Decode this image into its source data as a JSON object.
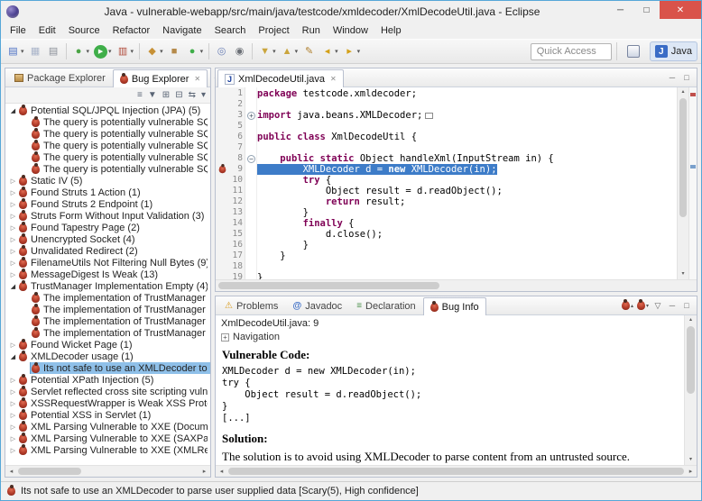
{
  "colors": {
    "window_border": "#56a7d8",
    "close_button": "#d9534a",
    "selection": "#3d7cc8",
    "tree_selection": "#8fc0e9",
    "keyword": "#7f0055",
    "bug": "#b03a28"
  },
  "window": {
    "title": "Java - vulnerable-webapp/src/main/java/testcode/xmldecoder/XmlDecodeUtil.java - Eclipse",
    "controls": {
      "minimize": "─",
      "maximize": "□",
      "close": "✕"
    }
  },
  "menubar": {
    "items": [
      "File",
      "Edit",
      "Source",
      "Refactor",
      "Navigate",
      "Search",
      "Project",
      "Run",
      "Window",
      "Help"
    ]
  },
  "toolbar": {
    "quick_access": "Quick Access",
    "perspective": "Java",
    "buttons": [
      {
        "name": "new-wizard",
        "glyph": "▤",
        "color": "#4a6fc4",
        "dropdown": true
      },
      {
        "name": "save",
        "glyph": "▦",
        "color": "#a9b4c9"
      },
      {
        "name": "print",
        "glyph": "▤",
        "color": "#8a8f98"
      },
      {
        "sep": true
      },
      {
        "name": "debug",
        "glyph": "●",
        "color": "#4ba446",
        "dropdown": true
      },
      {
        "name": "run",
        "glyph": "▶",
        "color": "#ffffff",
        "bg": "#3fae49",
        "dropdown": true
      },
      {
        "name": "coverage",
        "glyph": "▥",
        "color": "#b04a3a",
        "dropdown": true
      },
      {
        "sep": true
      },
      {
        "name": "new-java-project",
        "glyph": "◆",
        "color": "#c79136",
        "dropdown": true
      },
      {
        "name": "new-package",
        "glyph": "■",
        "color": "#b58a4a"
      },
      {
        "name": "new-class",
        "glyph": "●",
        "color": "#3fae49",
        "dropdown": true
      },
      {
        "sep": true
      },
      {
        "name": "open-type",
        "glyph": "◎",
        "color": "#6a7fb5"
      },
      {
        "name": "search",
        "glyph": "◉",
        "color": "#6b6f76"
      },
      {
        "sep": true
      },
      {
        "name": "next-annotation",
        "glyph": "▼",
        "color": "#caa53d",
        "dropdown": true
      },
      {
        "name": "previous-annotation",
        "glyph": "▲",
        "color": "#caa53d",
        "dropdown": true
      },
      {
        "name": "last-edit-location",
        "glyph": "✎",
        "color": "#b08030"
      },
      {
        "name": "back",
        "glyph": "◂",
        "color": "#d4a017",
        "dropdown": true
      },
      {
        "name": "forward",
        "glyph": "▸",
        "color": "#d4a017",
        "dropdown": true
      }
    ]
  },
  "panel_buttons": {
    "minimize": "─",
    "maximize": "□"
  },
  "left_panel": {
    "tabs": [
      {
        "label": "Package Explorer",
        "icon": "package",
        "active": false
      },
      {
        "label": "Bug Explorer",
        "icon": "bug",
        "active": true,
        "closable": true
      }
    ],
    "view_toolbar": [
      {
        "name": "group-by",
        "glyph": "≡"
      },
      {
        "name": "filter",
        "glyph": "▼"
      },
      {
        "name": "expand-all",
        "glyph": "⊞"
      },
      {
        "name": "collapse-all",
        "glyph": "⊟"
      },
      {
        "name": "link-with-editor",
        "glyph": "⇆"
      },
      {
        "name": "view-menu",
        "glyph": "▾"
      }
    ],
    "tree": [
      {
        "label": "Potential SQL/JPQL Injection (JPA) (5)",
        "state": "expanded",
        "level": 0
      },
      {
        "label": "The query is potentially vulnerable SQL,",
        "level": 1
      },
      {
        "label": "The query is potentially vulnerable SQL,",
        "level": 1
      },
      {
        "label": "The query is potentially vulnerable SQL,",
        "level": 1
      },
      {
        "label": "The query is potentially vulnerable SQL,",
        "level": 1
      },
      {
        "label": "The query is potentially vulnerable SQL,",
        "level": 1
      },
      {
        "label": "Static IV (5)",
        "state": "collapsed",
        "level": 0
      },
      {
        "label": "Found Struts 1 Action (1)",
        "state": "collapsed",
        "level": 0
      },
      {
        "label": "Found Struts 2 Endpoint (1)",
        "state": "collapsed",
        "level": 0
      },
      {
        "label": "Struts Form Without Input Validation (3)",
        "state": "collapsed",
        "level": 0
      },
      {
        "label": "Found Tapestry Page (2)",
        "state": "collapsed",
        "level": 0
      },
      {
        "label": "Unencrypted Socket (4)",
        "state": "collapsed",
        "level": 0
      },
      {
        "label": "Unvalidated Redirect (2)",
        "state": "collapsed",
        "level": 0
      },
      {
        "label": "FilenameUtils Not Filtering Null Bytes (9)",
        "state": "collapsed",
        "level": 0
      },
      {
        "label": "MessageDigest Is Weak (13)",
        "state": "collapsed",
        "level": 0
      },
      {
        "label": "TrustManager Implementation Empty (4)",
        "state": "expanded",
        "level": 0
      },
      {
        "label": "The implementation of TrustManager is",
        "level": 1
      },
      {
        "label": "The implementation of TrustManager is",
        "level": 1
      },
      {
        "label": "The implementation of TrustManager is",
        "level": 1
      },
      {
        "label": "The implementation of TrustManager is",
        "level": 1
      },
      {
        "label": "Found Wicket Page (1)",
        "state": "collapsed",
        "level": 0
      },
      {
        "label": "XMLDecoder usage (1)",
        "state": "expanded",
        "level": 0
      },
      {
        "label": "Its not safe to use an XMLDecoder to pa",
        "level": 1,
        "selected": true
      },
      {
        "label": "Potential XPath Injection (5)",
        "state": "collapsed",
        "level": 0
      },
      {
        "label": "Servlet reflected cross site scripting vulner",
        "state": "collapsed",
        "level": 0
      },
      {
        "label": "XSSRequestWrapper is Weak XSS Protectio",
        "state": "collapsed",
        "level": 0
      },
      {
        "label": "Potential XSS in Servlet (1)",
        "state": "collapsed",
        "level": 0
      },
      {
        "label": "XML Parsing Vulnerable to XXE (Documen",
        "state": "collapsed",
        "level": 0
      },
      {
        "label": "XML Parsing Vulnerable to XXE (SAXParser",
        "state": "collapsed",
        "level": 0
      },
      {
        "label": "XML Parsing Vulnerable to XXE (XMLReade",
        "state": "collapsed",
        "level": 0
      }
    ]
  },
  "editor": {
    "tabs": [
      {
        "label": "XmlDecodeUtil.java",
        "icon": "java-file",
        "active": true,
        "closable": true
      }
    ],
    "lines": [
      {
        "num": "1",
        "tokens": [
          [
            "k",
            "package"
          ],
          [
            "p",
            " testcode.xmldecoder;"
          ]
        ]
      },
      {
        "num": "2",
        "tokens": []
      },
      {
        "num": "3",
        "fold": "plus",
        "fold_box": true,
        "tokens": [
          [
            "k",
            "import"
          ],
          [
            "p",
            " java.beans.XMLDecoder;"
          ]
        ]
      },
      {
        "num": "5",
        "tokens": []
      },
      {
        "num": "6",
        "tokens": [
          [
            "k",
            "public"
          ],
          [
            "p",
            " "
          ],
          [
            "k",
            "class"
          ],
          [
            "p",
            " XmlDecodeUtil {"
          ]
        ]
      },
      {
        "num": "7",
        "tokens": []
      },
      {
        "num": "8",
        "fold": "minus",
        "tokens": [
          [
            "p",
            "    "
          ],
          [
            "k",
            "public"
          ],
          [
            "p",
            " "
          ],
          [
            "k",
            "static"
          ],
          [
            "p",
            " Object handleXml(InputStream in) {"
          ]
        ]
      },
      {
        "num": "9",
        "highlight": true,
        "bug": true,
        "tokens": [
          [
            "p",
            "        XMLDecoder d = "
          ],
          [
            "k",
            "new"
          ],
          [
            "p",
            " XMLDecoder(in);"
          ]
        ]
      },
      {
        "num": "10",
        "tokens": [
          [
            "p",
            "        "
          ],
          [
            "k",
            "try"
          ],
          [
            "p",
            " {"
          ]
        ]
      },
      {
        "num": "11",
        "tokens": [
          [
            "p",
            "            Object result = d.readObject();"
          ]
        ]
      },
      {
        "num": "12",
        "tokens": [
          [
            "p",
            "            "
          ],
          [
            "k",
            "return"
          ],
          [
            "p",
            " result;"
          ]
        ]
      },
      {
        "num": "13",
        "tokens": [
          [
            "p",
            "        }"
          ]
        ]
      },
      {
        "num": "14",
        "tokens": [
          [
            "p",
            "        "
          ],
          [
            "k",
            "finally"
          ],
          [
            "p",
            " {"
          ]
        ]
      },
      {
        "num": "15",
        "tokens": [
          [
            "p",
            "            d.close();"
          ]
        ]
      },
      {
        "num": "16",
        "tokens": [
          [
            "p",
            "        }"
          ]
        ]
      },
      {
        "num": "17",
        "tokens": [
          [
            "p",
            "    }"
          ]
        ]
      },
      {
        "num": "18",
        "tokens": []
      },
      {
        "num": "19",
        "tokens": [
          [
            "p",
            "}"
          ]
        ]
      }
    ]
  },
  "bottom_panel": {
    "tabs": [
      {
        "label": "Problems",
        "icon": "problems"
      },
      {
        "label": "Javadoc",
        "icon": "javadoc"
      },
      {
        "label": "Declaration",
        "icon": "declaration"
      },
      {
        "label": "Bug Info",
        "icon": "bug",
        "active": true
      }
    ],
    "view_buttons": [
      {
        "name": "previous-bug",
        "arrow": "▴"
      },
      {
        "name": "next-bug",
        "arrow": "▾"
      },
      {
        "name": "view-menu",
        "glyph": "▽"
      }
    ],
    "location": "XmlDecodeUtil.java: 9",
    "navigation_label": "Navigation",
    "vulnerable_code_heading": "Vulnerable Code:",
    "code_lines": [
      "XMLDecoder d = new XMLDecoder(in);",
      "try {",
      "    Object result = d.readObject();",
      "}",
      "[...]"
    ],
    "solution_heading": "Solution:",
    "solution_text": "The solution is to avoid using XMLDecoder to parse content from an untrusted source."
  },
  "statusbar": {
    "text": "Its not safe to use an XMLDecoder to parse user supplied data [Scary(5), High confidence]"
  }
}
